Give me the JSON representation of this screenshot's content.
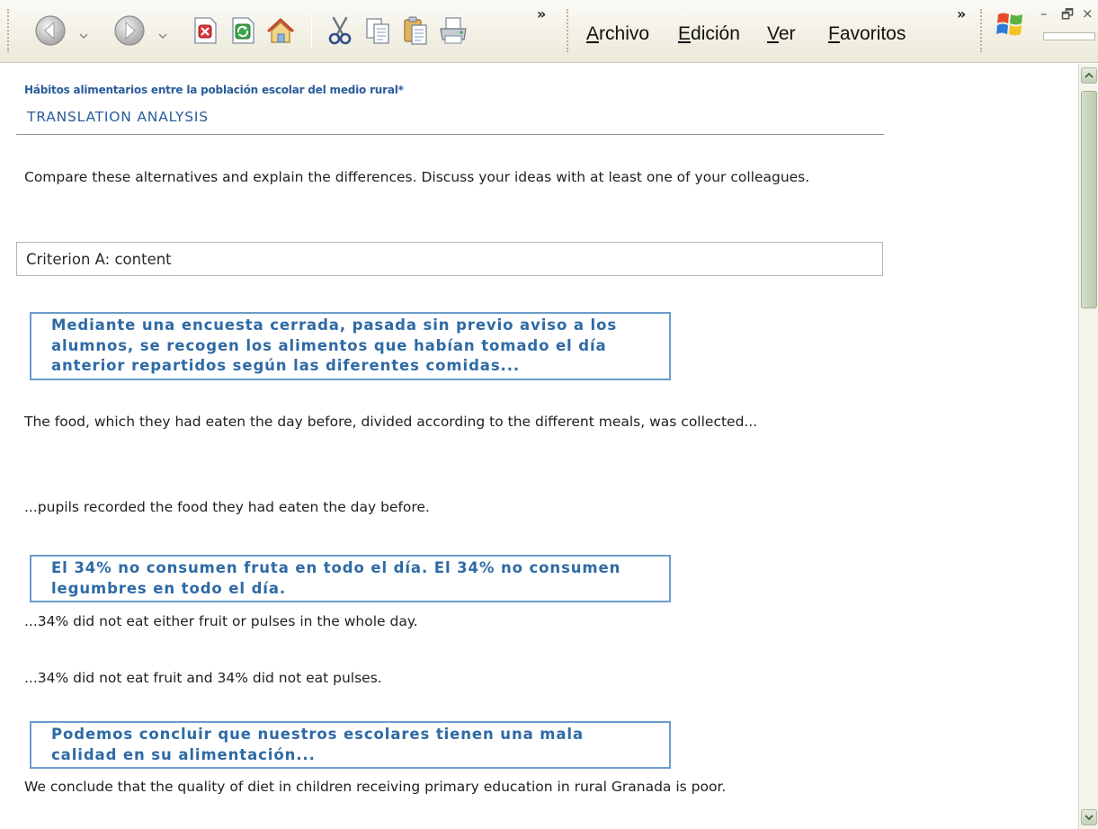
{
  "toolbar": {
    "buttons": [
      {
        "name": "back",
        "icon": "back-arrow-icon"
      },
      {
        "name": "forward",
        "icon": "forward-arrow-icon"
      },
      {
        "name": "stop",
        "icon": "stop-icon"
      },
      {
        "name": "refresh",
        "icon": "refresh-icon"
      },
      {
        "name": "home",
        "icon": "home-icon"
      },
      {
        "name": "cut",
        "icon": "scissors-icon"
      },
      {
        "name": "copy",
        "icon": "copy-icon"
      },
      {
        "name": "paste",
        "icon": "paste-icon"
      },
      {
        "name": "print",
        "icon": "printer-icon"
      }
    ],
    "overflow_chevron": "»",
    "menu": [
      {
        "accel": "A",
        "rest": "rchivo"
      },
      {
        "accel": "E",
        "rest": "dición"
      },
      {
        "accel": "V",
        "rest": "er"
      },
      {
        "accel": "F",
        "rest": "avoritos"
      }
    ],
    "menu_overflow_chevron": "»",
    "window_controls": {
      "minimize": "–",
      "restore": "🗗",
      "close": "×"
    }
  },
  "page": {
    "site_title": "Hábitos alimentarios entre la población escolar del medio rural*",
    "section_heading": "TRANSLATION ANALYSIS",
    "instructions": "Compare these alternatives and explain the differences. Discuss your ideas with at least one of your colleagues.",
    "criterion": "Criterion A: content",
    "blocks": [
      {
        "source": "Mediante una encuesta cerrada, pasada sin previo aviso a los alumnos, se recogen los alimentos que habían tomado el día anterior repartidos según las diferentes comidas...",
        "translations": [
          "The food, which they had eaten the day before, divided according to the different meals, was collected...",
          "...pupils recorded the food they had eaten the day before."
        ]
      },
      {
        "source": "El 34% no consumen fruta en todo el día. El 34% no consumen legumbres en todo el día.",
        "translations": [
          "...34% did not eat either fruit or pulses in the whole day.",
          "...34% did not eat fruit and 34% did not eat pulses."
        ]
      },
      {
        "source": "Podemos concluir que nuestros escolares tienen una mala calidad en su alimentación...",
        "translations": [
          "We conclude that the quality of diet in children receiving primary education in rural Granada is poor."
        ]
      }
    ]
  },
  "colors": {
    "heading_blue": "#2a5c9a",
    "quote_border": "#6b9bcb",
    "quote_text": "#2e6aa5",
    "toolbar_bg": "#ece9d8"
  }
}
